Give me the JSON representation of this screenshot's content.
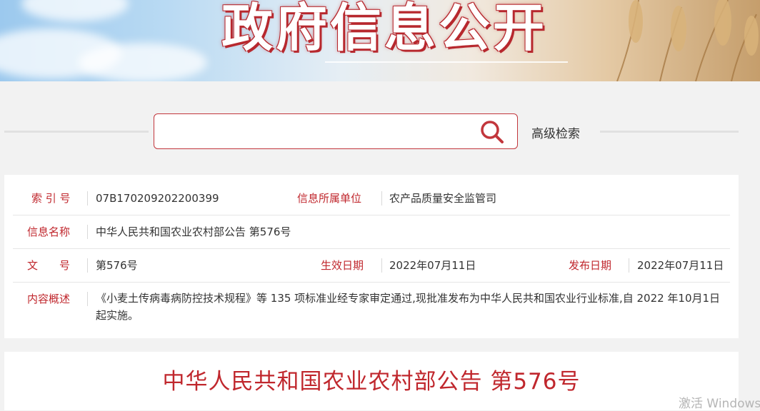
{
  "banner": {
    "title": "政府信息公开"
  },
  "search": {
    "placeholder": "",
    "advanced_label": "高级检索"
  },
  "info": {
    "index_label": "索 引 号",
    "index_value": "07B170209202200399",
    "unit_label": "信息所属单位",
    "unit_value": "农产品质量安全监管司",
    "name_label": "信息名称",
    "name_value": "中华人民共和国农业农村部公告 第576号",
    "docno_label": "文　　号",
    "docno_value": "第576号",
    "effective_label": "生效日期",
    "effective_value": "2022年07月11日",
    "publish_label": "发布日期",
    "publish_value": "2022年07月11日",
    "summary_label": "内容概述",
    "summary_value": "《小麦土传病毒病防控技术规程》等 135 项标准业经专家审定通过,现批准发布为中华人民共和国农业行业标准,自 2022 年10月1日起实施。"
  },
  "document": {
    "title": "中华人民共和国农业农村部公告 第576号"
  },
  "watermark": {
    "text": "激活 Windows"
  },
  "colors": {
    "accent": "#c0272d",
    "background": "#f2f2f2"
  },
  "icons": {
    "search": "search-icon"
  }
}
